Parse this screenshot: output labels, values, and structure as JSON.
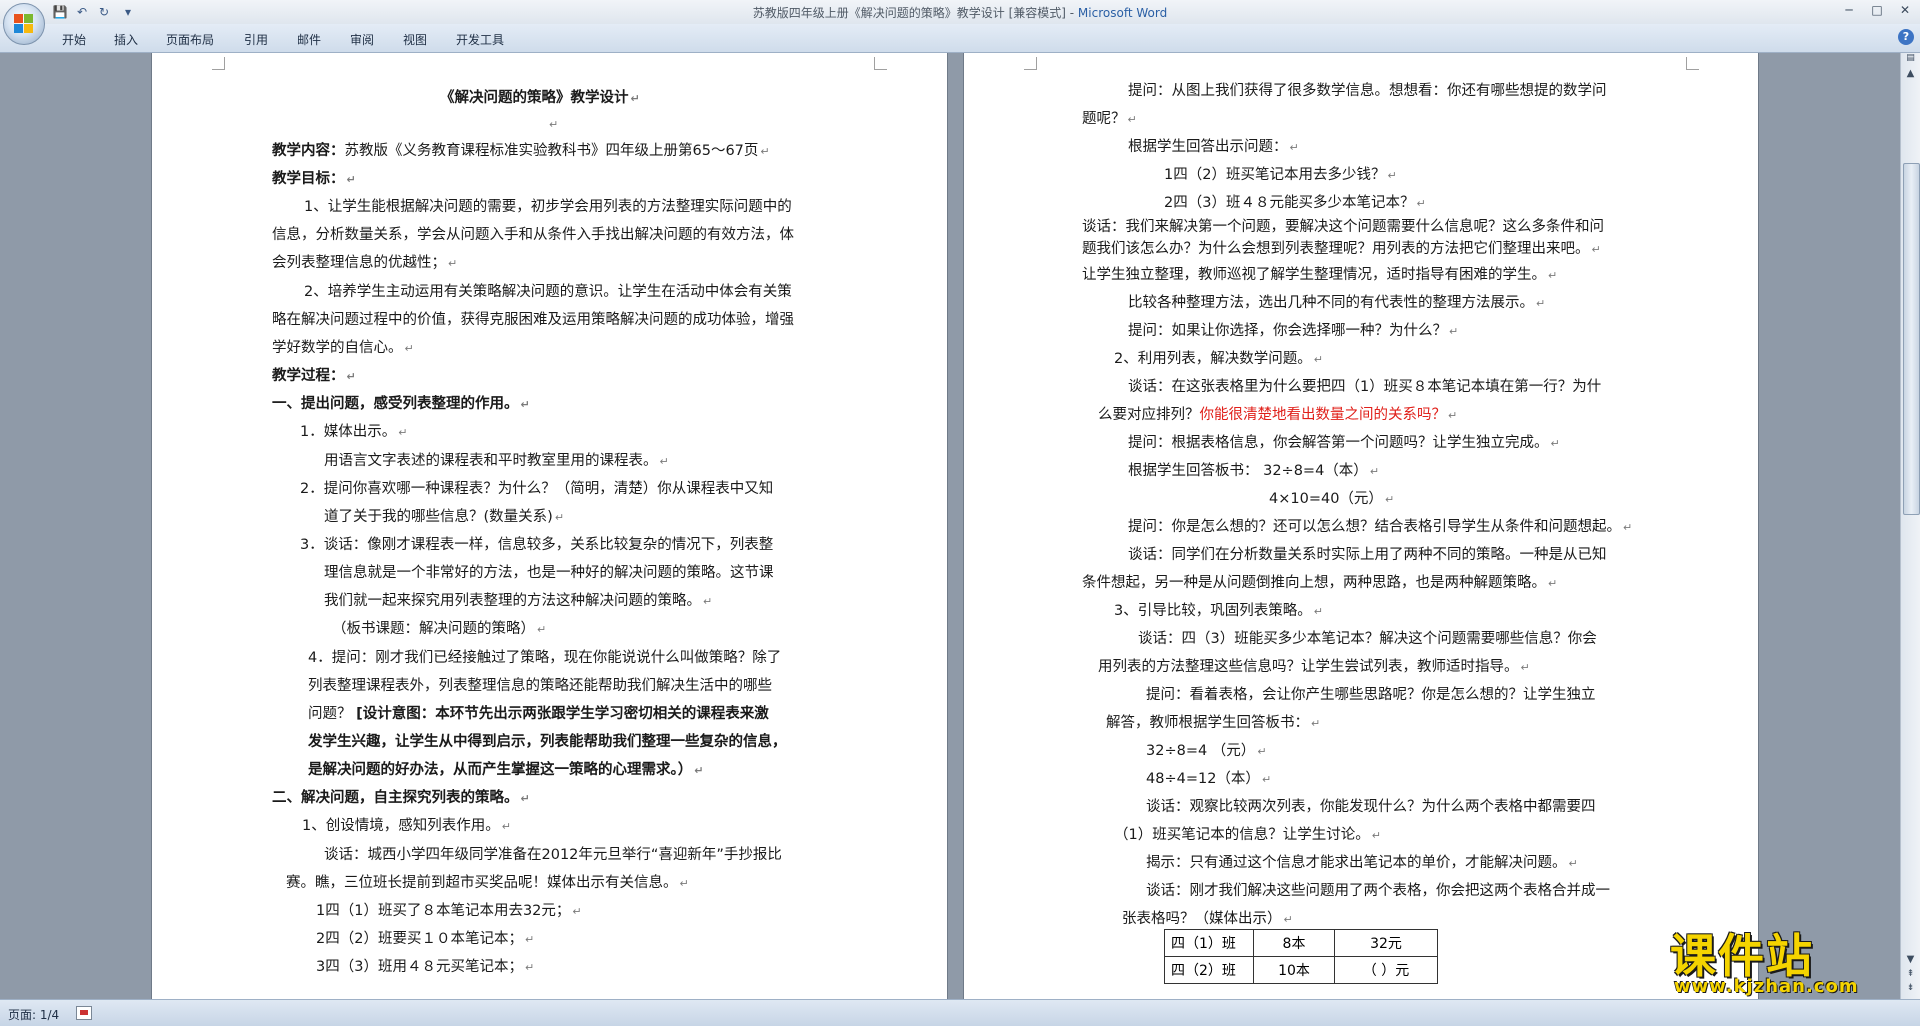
{
  "window": {
    "title": "苏教版四年级上册《解决问题的策略》教学设计 [兼容模式] - ",
    "app_name": "Microsoft Word"
  },
  "qat": {
    "save": "💾",
    "undo": "↶",
    "redo": "↻",
    "customize": "▾"
  },
  "window_controls": {
    "minimize": "─",
    "maximize": "□",
    "close": "✕"
  },
  "ribbon": {
    "tabs": [
      "开始",
      "插入",
      "页面布局",
      "引用",
      "邮件",
      "审阅",
      "视图",
      "开发工具"
    ],
    "help": "?"
  },
  "left_page": [
    "《解决问题的策略》教学设计",
    "",
    "教学内容：",
    "苏教版《义务教育课程标准实验教科书》四年级上册第65～67页",
    "教学目标：",
    "1、让学生能根据解决问题的需要，初步学会用列表的方法整理实际问题中的",
    "信息，分析数量关系，学会从问题入手和从条件入手找出解决问题的有效方法，体",
    "会列表整理信息的优越性；",
    "2、培养学生主动运用有关策略解决问题的意识。让学生在活动中体会有关策",
    "略在解决问题过程中的价值，获得克服困难及运用策略解决问题的成功体验，增强",
    "学好数学的自信心。",
    "教学过程：",
    "一、提出问题，感受列表整理的作用。",
    "1．媒体出示。",
    "用语言文字表述的课程表和平时教室里用的课程表。",
    "2．提问你喜欢哪一种课程表？为什么？（简明，清楚）你从课程表中又知",
    "道了关于我的哪些信息？(数量关系)",
    "3．谈话：像刚才课程表一样，信息较多，关系比较复杂的情况下，列表整",
    "理信息就是一个非常好的方法，也是一种好的解决问题的策略。这节课",
    "我们就一起来探究用列表整理的方法这种解决问题的策略。",
    "（板书课题：解决问题的策略）",
    "4．提问：刚才我们已经接触过了策略，现在你能说说什么叫做策略？除了",
    "列表整理课程表外，列表整理信息的策略还能帮助我们解决生活中的哪些",
    "问题？",
    "[设计意图：本环节先出示两张跟学生学习密切相关的课程表来激",
    "发学生兴趣，让学生从中得到启示，列表能帮助我们整理一些复杂的信息，",
    "是解决问题的好办法，从而产生掌握这一策略的心理需求。）",
    "二、解决问题，自主探究列表的策略。",
    "1、创设情境，感知列表作用。",
    "谈话：城西小学四年级同学准备在2012年元旦举行“喜迎新年”手抄报比",
    "赛。瞧，三位班长提前到超市买奖品呢！媒体出示有关信息。",
    "1四（1）班买了８本笔记本用去32元；",
    "2四（2）班要买１０本笔记本；",
    "3四（3）班用４８元买笔记本；"
  ],
  "right_page": [
    "提问：从图上我们获得了很多数学信息。想想看：你还有哪些想提的数学问",
    "题呢？",
    "根据学生回答出示问题：",
    "1四（2）班买笔记本用去多少钱？",
    "2四（3）班４８元能买多少本笔记本？",
    "谈话：我们来解决第一个问题，要解决这个问题需要什么信息呢？这么多条件和问",
    "题我们该怎么办？为什么会想到列表整理呢？用列表的方法把它们整理出来吧。",
    "让学生独立整理，教师巡视了解学生整理情况，适时指导有困难的学生。",
    "比较各种整理方法，选出几种不同的有代表性的整理方法展示。",
    "提问：如果让你选择，你会选择哪一种？为什么？",
    "2、利用列表，解决数学问题。",
    "谈话：在这张表格里为什么要把四（1）班买８本笔记本填在第一行？为什",
    "么要对应排列？",
    "你能很清楚地看出数量之间的关系吗？",
    "提问：根据表格信息，你会解答第一个问题吗？让学生独立完成。",
    "根据学生回答板书：  32÷8=4（本）",
    "4×10=40（元）",
    "提问：你是怎么想的？还可以怎么想？结合表格引导学生从条件和问题想起。",
    "谈话：同学们在分析数量关系时实际上用了两种不同的策略。一种是从已知",
    "条件想起，另一种是从问题倒推向上想，两种思路，也是两种解题策略。",
    "3、引导比较，巩固列表策略。",
    "谈话：四（3）班能买多少本笔记本？解决这个问题需要哪些信息？你会",
    "用列表的方法整理这些信息吗？让学生尝试列表，教师适时指导。",
    "提问：看着表格，会让你产生哪些思路呢？你是怎么想的？让学生独立",
    "解答，教师根据学生回答板书：",
    "32÷8=4 （元）",
    "48÷4=12（本）",
    "谈话：观察比较两次列表，你能发现什么？为什么两个表格中都需要四",
    "（1）班买笔记本的信息？让学生讨论。",
    "揭示：只有通过这个信息才能求出笔记本的单价，才能解决问题。",
    "谈话：刚才我们解决这些问题用了两个表格，你会把这两个表格合并成一",
    "张表格吗？（媒体出示）"
  ],
  "table": [
    [
      "四（1）班",
      "8本",
      "32元"
    ],
    [
      "四（2）班",
      "10本",
      "（   ）元"
    ]
  ],
  "status": {
    "page": "页面: 1/4"
  },
  "watermark": {
    "main": "课件站",
    "url": "www.kjzhan.com"
  },
  "colors": {
    "accent": "#2a5fa5",
    "highlight_red": "#e0201a",
    "watermark": "#f5d400"
  }
}
